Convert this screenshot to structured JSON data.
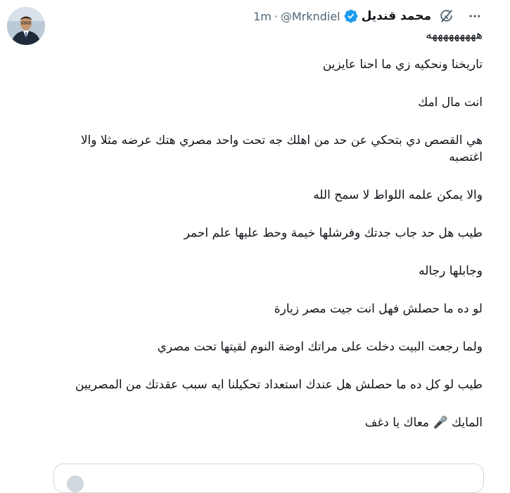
{
  "author": {
    "name": "محمد قنديل",
    "handle": "@Mrkndiel",
    "separator": "·",
    "time": "1m",
    "verified_icon": "verified-badge-icon",
    "avatar_icon": "profile-photo"
  },
  "actions": {
    "grok_icon": "grok-icon",
    "more_icon": "more-horizontal-icon"
  },
  "tweet": {
    "paragraphs": [
      "هههههههههه",
      "تاريخنا ونحكيه زي ما احنا عايزين",
      "انت مال امك",
      "هي القصص دي بتحكي عن حد من اهلك جه تحت واحد مصري هتك عرضه مثلا والا اغتصبه",
      "والا يمكن علمه اللواط لا سمح الله",
      "طيب هل حد جاب جدتك وفرشلها خيمة وحط عليها علم احمر",
      "وجابلها رجاله",
      "لو ده ما حصلش فهل انت جيت مصر زيارة",
      "ولما رجعت البيت دخلت على مراتك اوضة النوم لقيتها تحت مصري",
      "طيب لو كل ده ما حصلش هل عندك استعداد تحكيلنا ايه سبب عقدتك من المصريين",
      "المايك 🎤 معاك يا دغف"
    ]
  },
  "colors": {
    "text": "#0f1419",
    "muted": "#536471",
    "verified": "#1d9bf0",
    "border": "#cfd9de"
  }
}
